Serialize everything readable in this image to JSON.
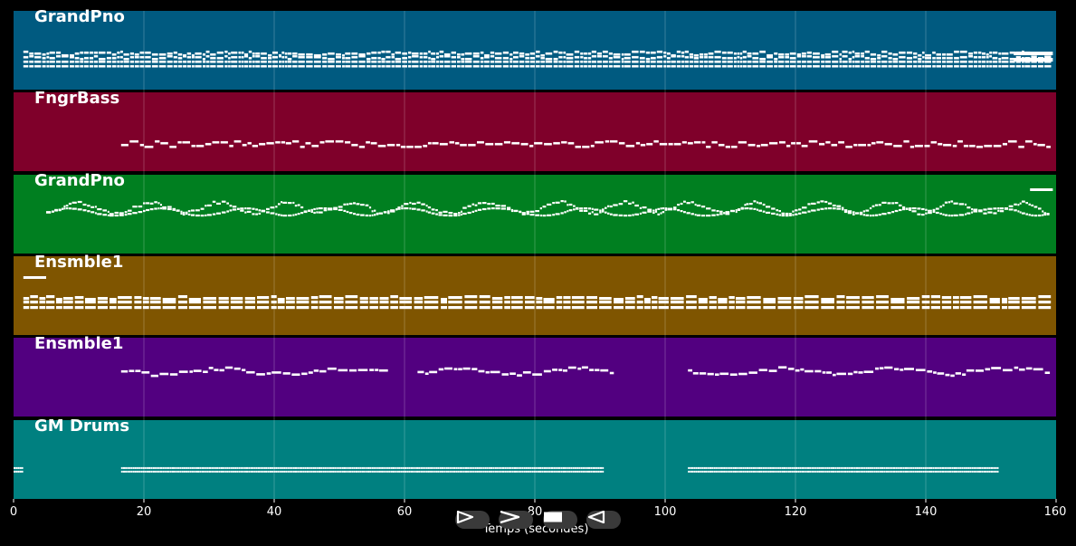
{
  "chart_data": {
    "type": "piano-roll",
    "xlabel": "Temps (secondes)",
    "xlim": [
      0,
      160
    ],
    "x_ticks": [
      "0",
      "20",
      "40",
      "60",
      "80",
      "100",
      "120",
      "140",
      "160"
    ],
    "grid": true,
    "tracks": [
      {
        "name": "GrandPno",
        "color": "#005a80",
        "pattern": "dense",
        "segments": [
          [
            1.5,
            159
          ]
        ],
        "pitch_range": [
          62,
          74
        ]
      },
      {
        "name": "FngrBass",
        "color": "#7f002a",
        "pattern": "bass",
        "segments": [
          [
            16.5,
            159
          ]
        ],
        "pitch_range": [
          40,
          45
        ]
      },
      {
        "name": "GrandPno",
        "color": "#007f20",
        "pattern": "melodyHigh",
        "segments": [
          [
            5,
            159
          ]
        ],
        "pitch_range": [
          64,
          76
        ]
      },
      {
        "name": "Ensmble1",
        "color": "#7f5500",
        "pattern": "chords",
        "segments": [
          [
            1.5,
            4.5
          ],
          [
            5,
            159
          ]
        ],
        "pitch_range": [
          60,
          72
        ]
      },
      {
        "name": "Ensmble1",
        "color": "#520080",
        "pattern": "melody",
        "segments": [
          [
            16.5,
            57.5
          ],
          [
            62,
            91.5
          ],
          [
            103.5,
            159
          ]
        ],
        "pitch_range": [
          62,
          70
        ]
      },
      {
        "name": "GM Drums",
        "color": "#008080",
        "pattern": "drums",
        "segments": [
          [
            0,
            1.5
          ],
          [
            16.5,
            90.5
          ],
          [
            103.5,
            151
          ]
        ],
        "pitch_range": [
          36,
          42
        ]
      }
    ]
  },
  "controls": [
    {
      "name": "play-forward-button",
      "icon": "play-icon"
    },
    {
      "name": "fast-forward-button",
      "icon": "forward-icon"
    },
    {
      "name": "stop-button",
      "icon": "stop-icon"
    },
    {
      "name": "play-backward-button",
      "icon": "reverse-icon"
    }
  ]
}
